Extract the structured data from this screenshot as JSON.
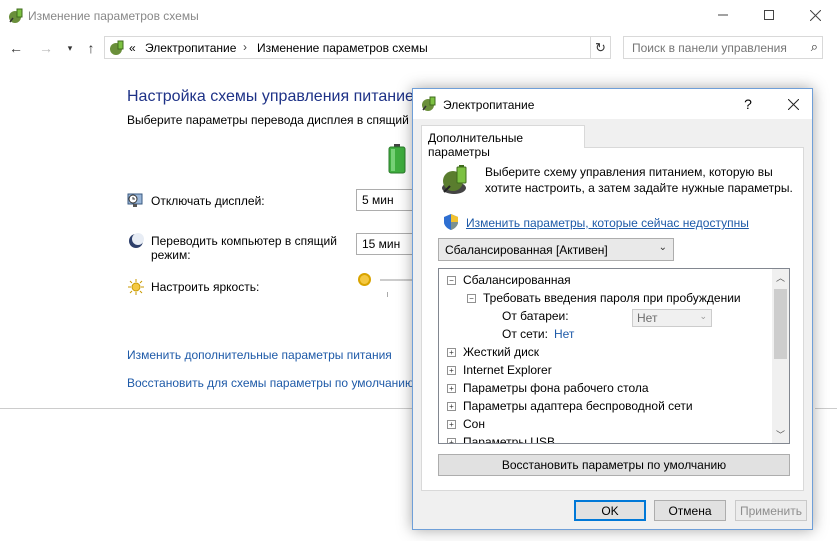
{
  "window": {
    "title": "Изменение параметров схемы"
  },
  "nav": {
    "overflow": "«",
    "breadcrumb": [
      "Электропитание",
      "Изменение параметров схемы"
    ],
    "search_placeholder": "Поиск в панели управления"
  },
  "main": {
    "title": "Настройка схемы управления питанием",
    "subtitle": "Выберите параметры перевода дисплея в спящий",
    "settings": [
      {
        "label": "Отключать дисплей:",
        "value": "5 мин"
      },
      {
        "label": "Переводить компьютер в спящий режим:",
        "value": "15 мин"
      },
      {
        "label": "Настроить яркость:"
      }
    ],
    "links": [
      "Изменить дополнительные параметры питания",
      "Восстановить для схемы параметры по умолчанию"
    ]
  },
  "dialog": {
    "title": "Электропитание",
    "help": "?",
    "tab": "Дополнительные параметры",
    "description": "Выберите схему управления питанием, которую вы хотите настроить, а затем задайте нужные параметры.",
    "link": "Изменить параметры, которые сейчас недоступны",
    "plan_selected": "Сбалансированная [Активен]",
    "tree": [
      {
        "label": "Сбалансированная",
        "level": 0,
        "expanded": true
      },
      {
        "label": "Требовать введения пароля при пробуждении",
        "level": 1,
        "expanded": true
      },
      {
        "label": "От батареи:",
        "level": 2,
        "value": "Нет"
      },
      {
        "label": "От сети:",
        "level": 2,
        "value": "Нет"
      },
      {
        "label": "Жесткий диск",
        "level": 0,
        "expanded": false
      },
      {
        "label": "Internet Explorer",
        "level": 0,
        "expanded": false
      },
      {
        "label": "Параметры фона рабочего стола",
        "level": 0,
        "expanded": false
      },
      {
        "label": "Параметры адаптера беспроводной сети",
        "level": 0,
        "expanded": false
      },
      {
        "label": "Сон",
        "level": 0,
        "expanded": false
      },
      {
        "label": "Параметры USB",
        "level": 0,
        "expanded": false
      }
    ],
    "restore_button": "Восстановить параметры по умолчанию",
    "ok": "OK",
    "cancel": "Отмена",
    "apply": "Применить"
  },
  "colors": {
    "title_blue": "#1e3287",
    "link_blue": "#1e5aa8",
    "accent": "#0078d7"
  }
}
